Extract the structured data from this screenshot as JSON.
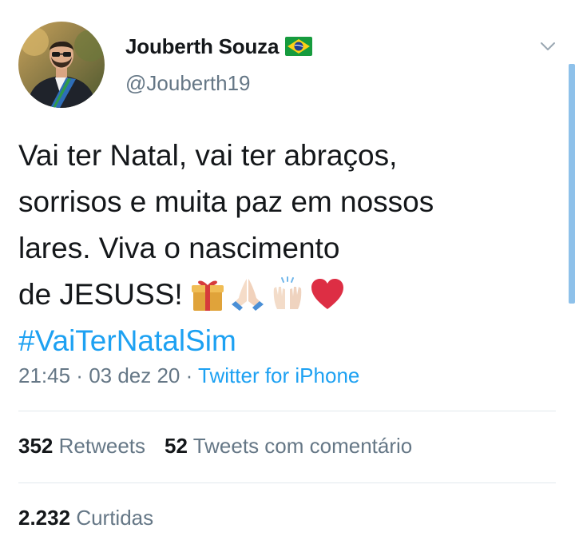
{
  "author": {
    "display_name": "Jouberth Souza",
    "handle": "@Jouberth19",
    "flag_icon": "brazil-flag-icon",
    "avatar_icon": "avatar-photo"
  },
  "tweet": {
    "lines": [
      "Vai ter Natal, vai ter abraços,",
      "sorrisos e muita paz em nossos",
      "lares. Viva o nascimento",
      "de JESUSS!"
    ],
    "emojis": [
      "gift-icon",
      "folded-hands-icon",
      "raised-hands-icon",
      "red-heart-icon"
    ],
    "hashtag": "#VaiTerNatalSim"
  },
  "meta": {
    "time": "21:45",
    "sep1": " · ",
    "date": "03 dez 20",
    "sep2": " · ",
    "source": "Twitter for iPhone"
  },
  "stats": {
    "retweets_count": "352",
    "retweets_label": "Retweets",
    "quotes_count": "52",
    "quotes_label": "Tweets com comentário",
    "likes_count": "2.232",
    "likes_label": "Curtidas"
  },
  "colors": {
    "link": "#1da1f2",
    "secondary": "#657786",
    "primary": "#14171a",
    "divider": "#e1e8ed"
  }
}
